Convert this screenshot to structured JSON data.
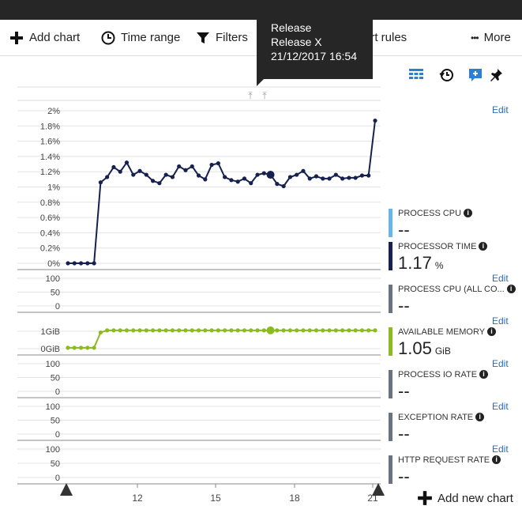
{
  "topbar": {
    "text": ""
  },
  "toolbar": {
    "add_chart": "Add chart",
    "time_range": "Time range",
    "filters": "Filters",
    "alert_rules_partial": "ert rules",
    "more": "More",
    "more_dots": "•••"
  },
  "tooltip": {
    "line1": "Release",
    "line2": "Release X",
    "line3": "21/12/2017 16:54"
  },
  "edit_label": "Edit",
  "add_new_chart": "Add new chart",
  "metrics": [
    {
      "name": "PROCESS CPU",
      "value": "--",
      "unit": "",
      "color": "#69b4e8"
    },
    {
      "name": "PROCESSOR TIME",
      "value": "1.17",
      "unit": "%",
      "color": "#16214f"
    },
    {
      "name": "PROCESS CPU (ALL CO...",
      "value": "--",
      "unit": "",
      "color": "#6b7280"
    },
    {
      "name": "AVAILABLE MEMORY",
      "value": "1.05",
      "unit": "GiB",
      "color": "#8cbb1f"
    },
    {
      "name": "PROCESS IO RATE",
      "value": "--",
      "unit": "",
      "color": "#6b7280"
    },
    {
      "name": "EXCEPTION RATE",
      "value": "--",
      "unit": "",
      "color": "#6b7280"
    },
    {
      "name": "HTTP REQUEST RATE",
      "value": "--",
      "unit": "",
      "color": "#6b7280"
    }
  ],
  "chart_data": {
    "type": "line",
    "x_ticks": [
      "12",
      "15",
      "18",
      "21"
    ],
    "panels": [
      {
        "id": "cpu",
        "y_ticks": [
          "2%",
          "1.8%",
          "1.6%",
          "1.4%",
          "1.2%",
          "1%",
          "0.8%",
          "0.6%",
          "0.4%",
          "0.2%",
          "0%"
        ],
        "ylim": [
          0,
          2
        ],
        "color": "#16214f",
        "values": [
          0,
          0,
          0,
          0,
          0,
          1.06,
          1.13,
          1.26,
          1.2,
          1.32,
          1.16,
          1.21,
          1.16,
          1.08,
          1.05,
          1.16,
          1.13,
          1.27,
          1.22,
          1.27,
          1.15,
          1.1,
          1.29,
          1.31,
          1.13,
          1.09,
          1.07,
          1.11,
          1.05,
          1.16,
          1.18,
          1.16,
          1.04,
          1.01,
          1.13,
          1.16,
          1.21,
          1.11,
          1.14,
          1.11,
          1.11,
          1.16,
          1.11,
          1.12,
          1.12,
          1.15,
          1.15,
          1.87
        ],
        "highlight_index": 31
      },
      {
        "id": "cpu-all",
        "y_ticks": [
          "100",
          "50",
          "0"
        ],
        "values": []
      },
      {
        "id": "memory",
        "y_ticks": [
          "1GiB",
          "0GiB"
        ],
        "ylim": [
          0,
          1
        ],
        "color": "#8cbb1f",
        "values": [
          0.05,
          0.05,
          0.05,
          0.05,
          0.05,
          0.93,
          1.05,
          1.05,
          1.05,
          1.05,
          1.05,
          1.05,
          1.05,
          1.05,
          1.05,
          1.05,
          1.05,
          1.05,
          1.05,
          1.05,
          1.05,
          1.05,
          1.05,
          1.05,
          1.05,
          1.05,
          1.05,
          1.05,
          1.05,
          1.05,
          1.05,
          1.05,
          1.05,
          1.05,
          1.05,
          1.05,
          1.05,
          1.05,
          1.05,
          1.05,
          1.05,
          1.05,
          1.05,
          1.05,
          1.05,
          1.05,
          1.05,
          1.05
        ],
        "highlight_index": 31
      },
      {
        "id": "io",
        "y_ticks": [
          "100",
          "50",
          "0"
        ],
        "values": []
      },
      {
        "id": "exception",
        "y_ticks": [
          "100",
          "50",
          "0"
        ],
        "values": []
      },
      {
        "id": "http",
        "y_ticks": [
          "100",
          "50",
          "0"
        ],
        "values": []
      }
    ]
  }
}
